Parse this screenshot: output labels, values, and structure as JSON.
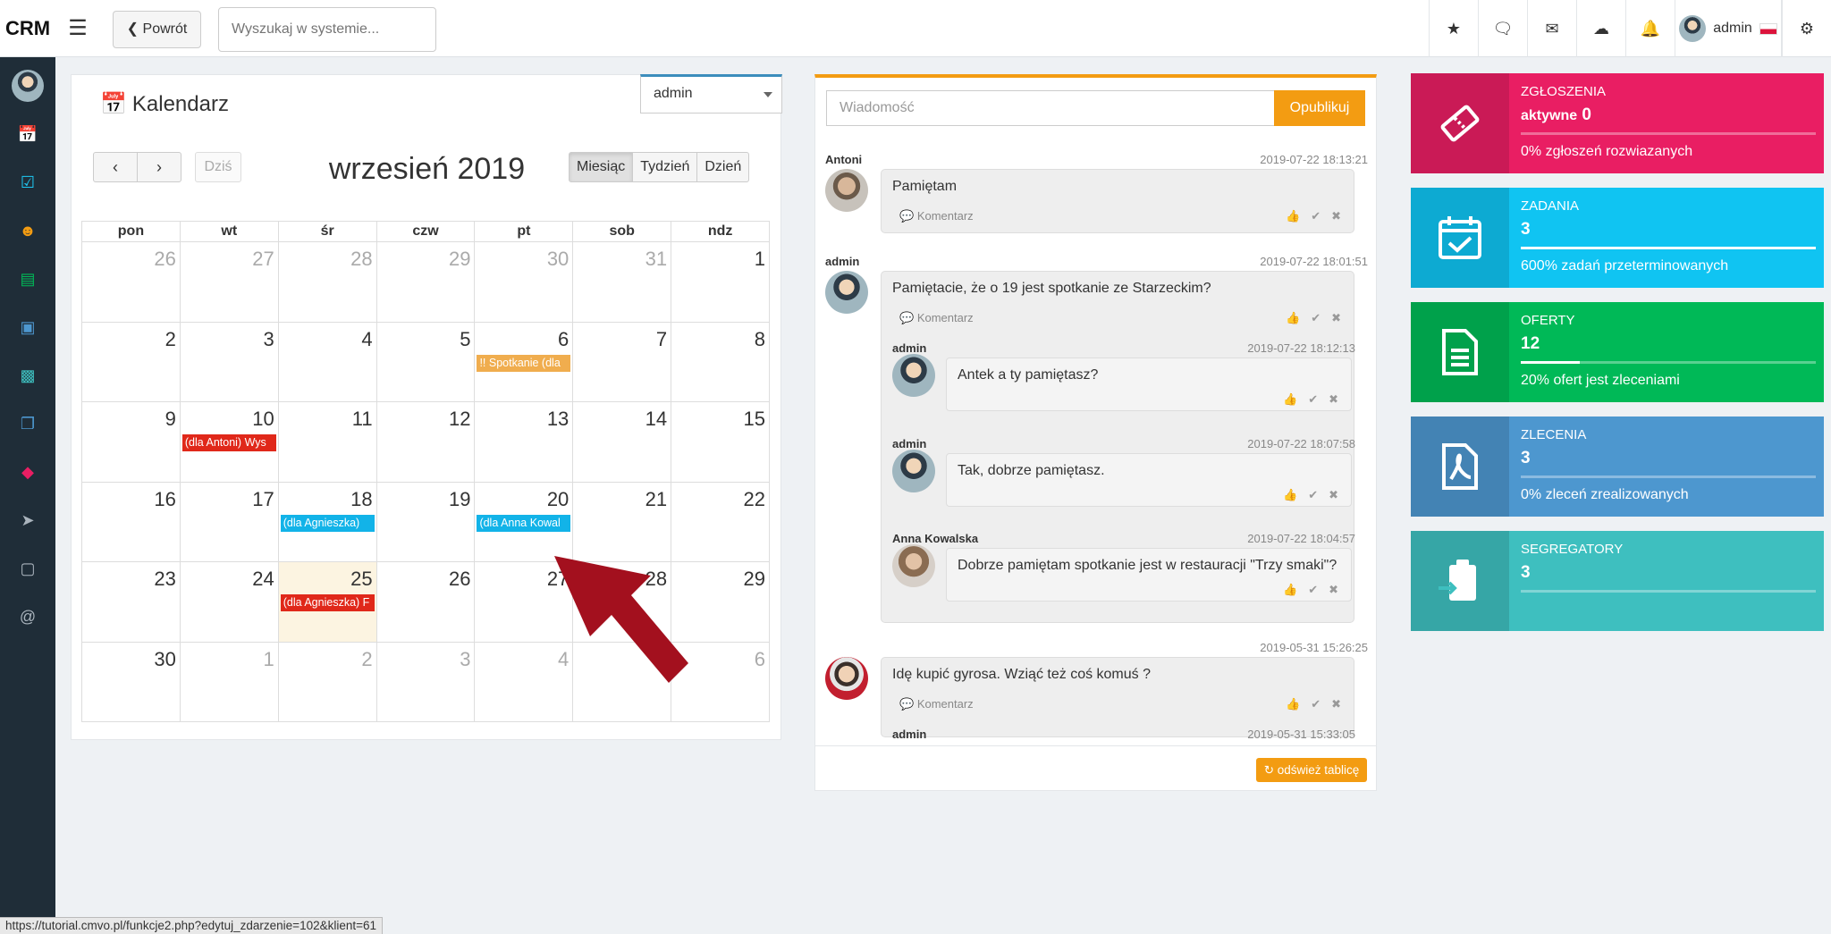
{
  "app": {
    "logo": "CRM"
  },
  "topbar": {
    "back_label": "Powrót",
    "search_placeholder": "Wyszukaj w systemie...",
    "username": "admin"
  },
  "calendar": {
    "title": "Kalendarz",
    "user_filter": "admin",
    "today_label": "Dziś",
    "month_title": "wrzesień 2019",
    "views": [
      "Miesiąc",
      "Tydzień",
      "Dzień"
    ],
    "days_of_week": [
      "pon",
      "wt",
      "śr",
      "czw",
      "pt",
      "sob",
      "ndz"
    ],
    "weeks": [
      [
        {
          "n": "26",
          "o": true
        },
        {
          "n": "27",
          "o": true
        },
        {
          "n": "28",
          "o": true
        },
        {
          "n": "29",
          "o": true
        },
        {
          "n": "30",
          "o": true
        },
        {
          "n": "31",
          "o": true
        },
        {
          "n": "1"
        }
      ],
      [
        {
          "n": "2"
        },
        {
          "n": "3"
        },
        {
          "n": "4"
        },
        {
          "n": "5"
        },
        {
          "n": "6",
          "ev": "!! Spotkanie (dla",
          "c": "#f0ad4e"
        },
        {
          "n": "7"
        },
        {
          "n": "8"
        }
      ],
      [
        {
          "n": "9"
        },
        {
          "n": "10",
          "ev": "(dla Antoni) Wys",
          "c": "#e0281a"
        },
        {
          "n": "11"
        },
        {
          "n": "12"
        },
        {
          "n": "13"
        },
        {
          "n": "14"
        },
        {
          "n": "15"
        }
      ],
      [
        {
          "n": "16"
        },
        {
          "n": "17"
        },
        {
          "n": "18",
          "ev": "(dla Agnieszka)",
          "c": "#12b3e8"
        },
        {
          "n": "19"
        },
        {
          "n": "20",
          "ev": "(dla Anna Kowal",
          "c": "#12b3e8"
        },
        {
          "n": "21"
        },
        {
          "n": "22"
        }
      ],
      [
        {
          "n": "23"
        },
        {
          "n": "24"
        },
        {
          "n": "25",
          "t": true,
          "ev": "(dla Agnieszka) F",
          "c": "#e0281a"
        },
        {
          "n": "26"
        },
        {
          "n": "27"
        },
        {
          "n": "28"
        },
        {
          "n": "29"
        }
      ],
      [
        {
          "n": "30"
        },
        {
          "n": "1",
          "o": true
        },
        {
          "n": "2",
          "o": true
        },
        {
          "n": "3",
          "o": true
        },
        {
          "n": "4",
          "o": true
        },
        {
          "n": "5",
          "o": true
        },
        {
          "n": "6",
          "o": true
        }
      ]
    ]
  },
  "wall": {
    "input_placeholder": "Wiadomość",
    "publish_label": "Opublikuj",
    "comment_label": "Komentarz",
    "refresh_label": "odśwież tablicę",
    "posts": [
      {
        "author": "Antoni",
        "date": "2019-07-22 18:13:21",
        "text": "Pamiętam"
      },
      {
        "author": "admin",
        "date": "2019-07-22 18:01:51",
        "text": "Pamiętacie, że o 19 jest spotkanie ze Starzeckim?",
        "replies": [
          {
            "author": "admin",
            "date": "2019-07-22 18:12:13",
            "text": "Antek a ty pamiętasz?"
          },
          {
            "author": "admin",
            "date": "2019-07-22 18:07:58",
            "text": "Tak, dobrze pamiętasz."
          },
          {
            "author": "Anna Kowalska",
            "date": "2019-07-22 18:04:57",
            "text": "Dobrze pamiętam spotkanie jest w restauracji \"Trzy smaki\"?"
          }
        ]
      },
      {
        "author": "",
        "date": "2019-05-31 15:26:25",
        "text": "Idę kupić gyrosa. Wziąć też coś komuś ?",
        "replies": [
          {
            "author": "admin",
            "date": "2019-05-31 15:33:05"
          }
        ]
      }
    ]
  },
  "tiles": [
    {
      "label": "ZGŁOSZENIA",
      "value_prefix": "aktywne",
      "value": "0",
      "progress": 0,
      "desc": "0% zgłoszeń rozwiazanych",
      "color": "#e91e63",
      "icon": "ticket-icon"
    },
    {
      "label": "ZADANIA",
      "value": "3",
      "progress": 1,
      "desc": "600% zadań przeterminowanych",
      "color": "#10c4f2",
      "icon": "calendar-check-icon"
    },
    {
      "label": "OFERTY",
      "value": "12",
      "progress": 0.2,
      "desc": "20% ofert jest zleceniami",
      "color": "#00b957",
      "icon": "document-icon"
    },
    {
      "label": "ZLECENIA",
      "value": "3",
      "progress": 0,
      "desc": "0% zleceń zrealizowanych",
      "color": "#4d97cf",
      "icon": "pdf-icon"
    },
    {
      "label": "SEGREGATORY",
      "value": "3",
      "progress": 0,
      "desc": "",
      "color": "#3ebfbf",
      "icon": "clipboard-icon"
    }
  ],
  "statusbar": {
    "url": "https://tutorial.cmvo.pl/funkcje2.php?edytuj_zdarzenie=102&klient=61"
  }
}
